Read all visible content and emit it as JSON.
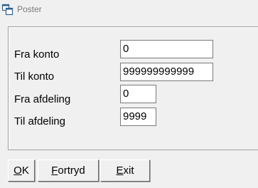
{
  "window": {
    "title": "Poster",
    "icon": "windows-cascade-icon"
  },
  "form": {
    "fields": [
      {
        "label": "Fra konto",
        "value": "0"
      },
      {
        "label": "Til konto",
        "value": "999999999999"
      },
      {
        "label": "Fra afdeling",
        "value": "0"
      },
      {
        "label": "Til afdeling",
        "value": "9999"
      }
    ]
  },
  "buttons": {
    "ok": {
      "mnemonic": "O",
      "rest": "K"
    },
    "cancel": {
      "mnemonic": "F",
      "rest": "ortryd"
    },
    "exit": {
      "mnemonic": "E",
      "rest": "xit"
    }
  }
}
